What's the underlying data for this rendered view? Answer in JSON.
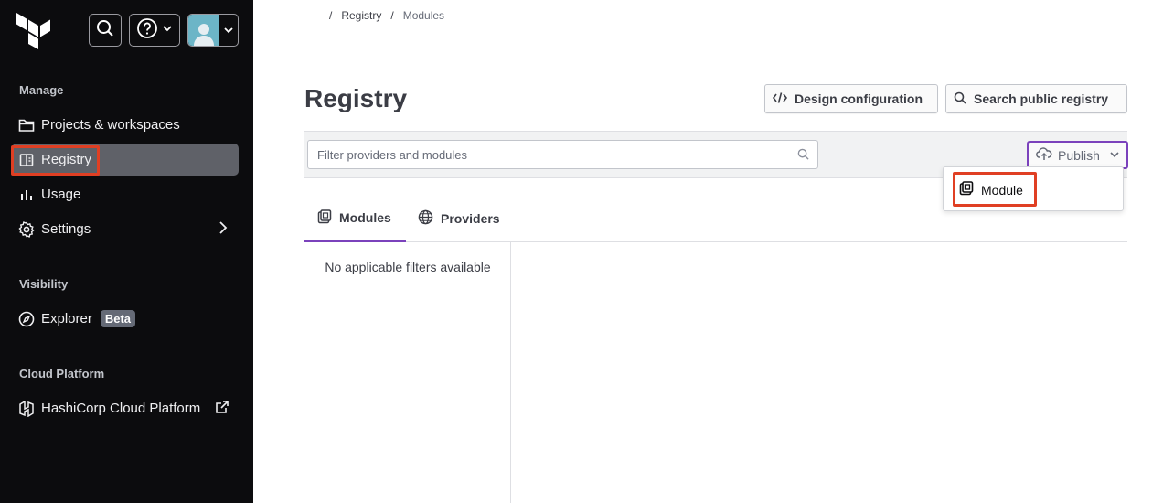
{
  "header": {
    "breadcrumb": [
      "Registry",
      "Modules"
    ]
  },
  "sidebar": {
    "sections": [
      {
        "label": "Manage"
      },
      {
        "label": "Visibility"
      },
      {
        "label": "Cloud Platform"
      }
    ],
    "items": [
      {
        "label": "Projects & workspaces",
        "icon": "folder-icon"
      },
      {
        "label": "Registry",
        "icon": "registry-icon",
        "active": true
      },
      {
        "label": "Usage",
        "icon": "bar-chart-icon"
      },
      {
        "label": "Settings",
        "icon": "gear-icon"
      },
      {
        "label": "Explorer",
        "icon": "compass-icon",
        "badge": "Beta"
      },
      {
        "label": "HashiCorp Cloud Platform",
        "icon": "hashicorp-icon"
      }
    ]
  },
  "main": {
    "title": "Registry",
    "design_button": "Design configuration",
    "search_button": "Search public registry",
    "filter_placeholder": "Filter providers and modules",
    "publish_button": "Publish",
    "publish_menu": [
      "Module"
    ],
    "tabs": [
      {
        "label": "Modules",
        "active": true
      },
      {
        "label": "Providers"
      }
    ],
    "no_filters_text": "No applicable filters available"
  },
  "colors": {
    "sidebar_bg": "#0c0c0e",
    "accent": "#7b42bc",
    "highlight": "#e03f23"
  }
}
